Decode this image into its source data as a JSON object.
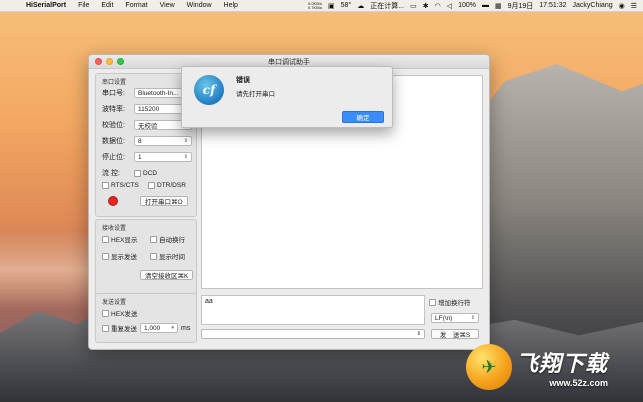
{
  "menubar": {
    "app_name": "HiSerialPort",
    "menus": [
      "File",
      "Edit",
      "Format",
      "View",
      "Window",
      "Help"
    ],
    "net_up": "0.0KB/s",
    "net_down": "0.7KB/s",
    "temp": "58°",
    "status_text": "正在计算...",
    "battery": "100%",
    "date": "9月19日",
    "time": "17:51:32",
    "user": "JackyChiang"
  },
  "window": {
    "title": "串口调试助手"
  },
  "serial_settings": {
    "group_label": "串口设置",
    "port_label": "串口号:",
    "port_value": "Bluetooth-In...",
    "baud_label": "波特率:",
    "baud_value": "115200",
    "parity_label": "校验位:",
    "parity_value": "无校验",
    "databits_label": "数据位:",
    "databits_value": "8",
    "stopbits_label": "停止位:",
    "stopbits_value": "1",
    "flow_label": "流    控:",
    "dcd_label": "DCD",
    "rts_label": "RTS/CTS",
    "dtr_label": "DTR/DSR",
    "open_button": "打开串口⌘O"
  },
  "receive_settings": {
    "group_label": "接收设置",
    "hex_display": "HEX显示",
    "auto_wrap": "自动换行",
    "show_send": "显示发送",
    "show_time": "显示时间",
    "clear_button": "清空接收区⌘K"
  },
  "send_settings": {
    "group_label": "发送设置",
    "hex_send": "HEX发送",
    "repeat_send": "重复发送",
    "interval_value": "1,000",
    "interval_unit": "ms",
    "add_newline": "增加换行符",
    "newline_value": "LF(\\n)",
    "send_button": "发　送⌘S",
    "send_text": "aa"
  },
  "alert": {
    "title": "错误",
    "message": "请先打开串口",
    "ok_button": "确定",
    "icon_text": "cf"
  },
  "watermark": {
    "brand": "飞翔下载",
    "url": "www.52z.com"
  }
}
